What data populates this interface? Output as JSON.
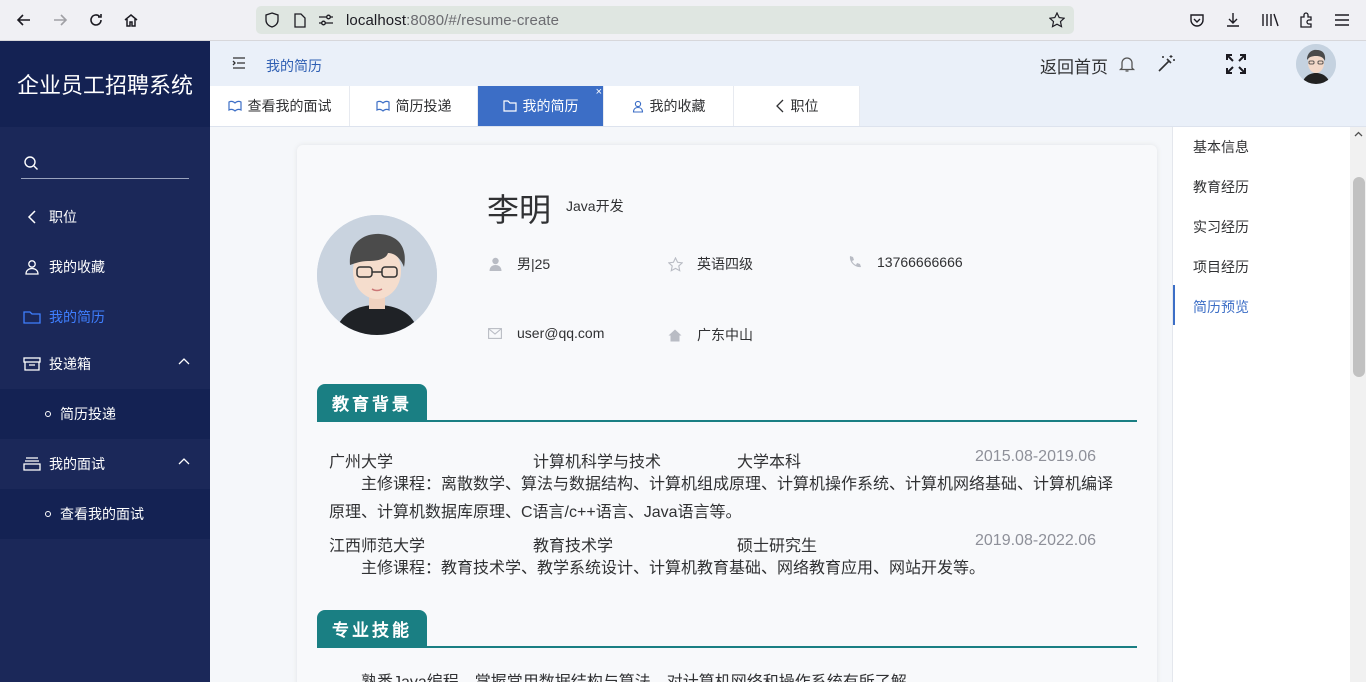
{
  "browser": {
    "url_host": "localhost",
    "url_rest": ":8080/#/resume-create"
  },
  "sidebar": {
    "title": "企业员工招聘系统",
    "search_placeholder": "",
    "items": [
      {
        "label": "职位",
        "icon": "chevron-left-icon"
      },
      {
        "label": "我的收藏",
        "icon": "user-icon"
      },
      {
        "label": "我的简历",
        "icon": "folder-icon",
        "active": true
      },
      {
        "label": "投递箱",
        "icon": "inbox-icon"
      },
      {
        "label": "简历投递",
        "icon": "dot"
      },
      {
        "label": "我的面试",
        "icon": "box-icon"
      },
      {
        "label": "查看我的面试",
        "icon": "dot"
      }
    ]
  },
  "header": {
    "breadcrumb": "我的简历",
    "home_link": "返回首页"
  },
  "tabs": [
    {
      "label": "查看我的面试",
      "icon": "book-icon"
    },
    {
      "label": "简历投递",
      "icon": "book-icon"
    },
    {
      "label": "我的简历",
      "icon": "folder-icon",
      "active": true,
      "close": "×"
    },
    {
      "label": "我的收藏",
      "icon": "user-icon"
    },
    {
      "label": "职位",
      "icon": "chevron-left-icon"
    }
  ],
  "resume": {
    "name": "李明",
    "job": "Java开发",
    "gender_age": "男|25",
    "english": "英语四级",
    "phone": "13766666666",
    "email": "user@qq.com",
    "location": "广东中山",
    "education_title": "教育背景",
    "education": [
      {
        "school": "广州大学",
        "major": "计算机科学与技术",
        "degree": "大学本科",
        "date": "2015.08-2019.06",
        "courses": "主修课程：离散数学、算法与数据结构、计算机组成原理、计算机操作系统、计算机网络基础、计算机编译原理、计算机数据库原理、C语言/c++语言、Java语言等。"
      },
      {
        "school": "江西师范大学",
        "major": "教育技术学",
        "degree": "硕士研究生",
        "date": "2019.08-2022.06",
        "courses": "主修课程：教育技术学、教学系统设计、计算机教育基础、网络教育应用、网站开发等。"
      }
    ],
    "skills_title": "专业技能",
    "skills_text": "熟悉Java编程，掌握常用数据结构与算法，对计算机网络和操作系统有所了解。"
  },
  "anchor_nav": [
    "基本信息",
    "教育经历",
    "实习经历",
    "项目经历",
    "简历预览"
  ],
  "colors": {
    "sidebar_bg": "#1b2859",
    "accent": "#3c6ec6",
    "section": "#1a7f83"
  }
}
